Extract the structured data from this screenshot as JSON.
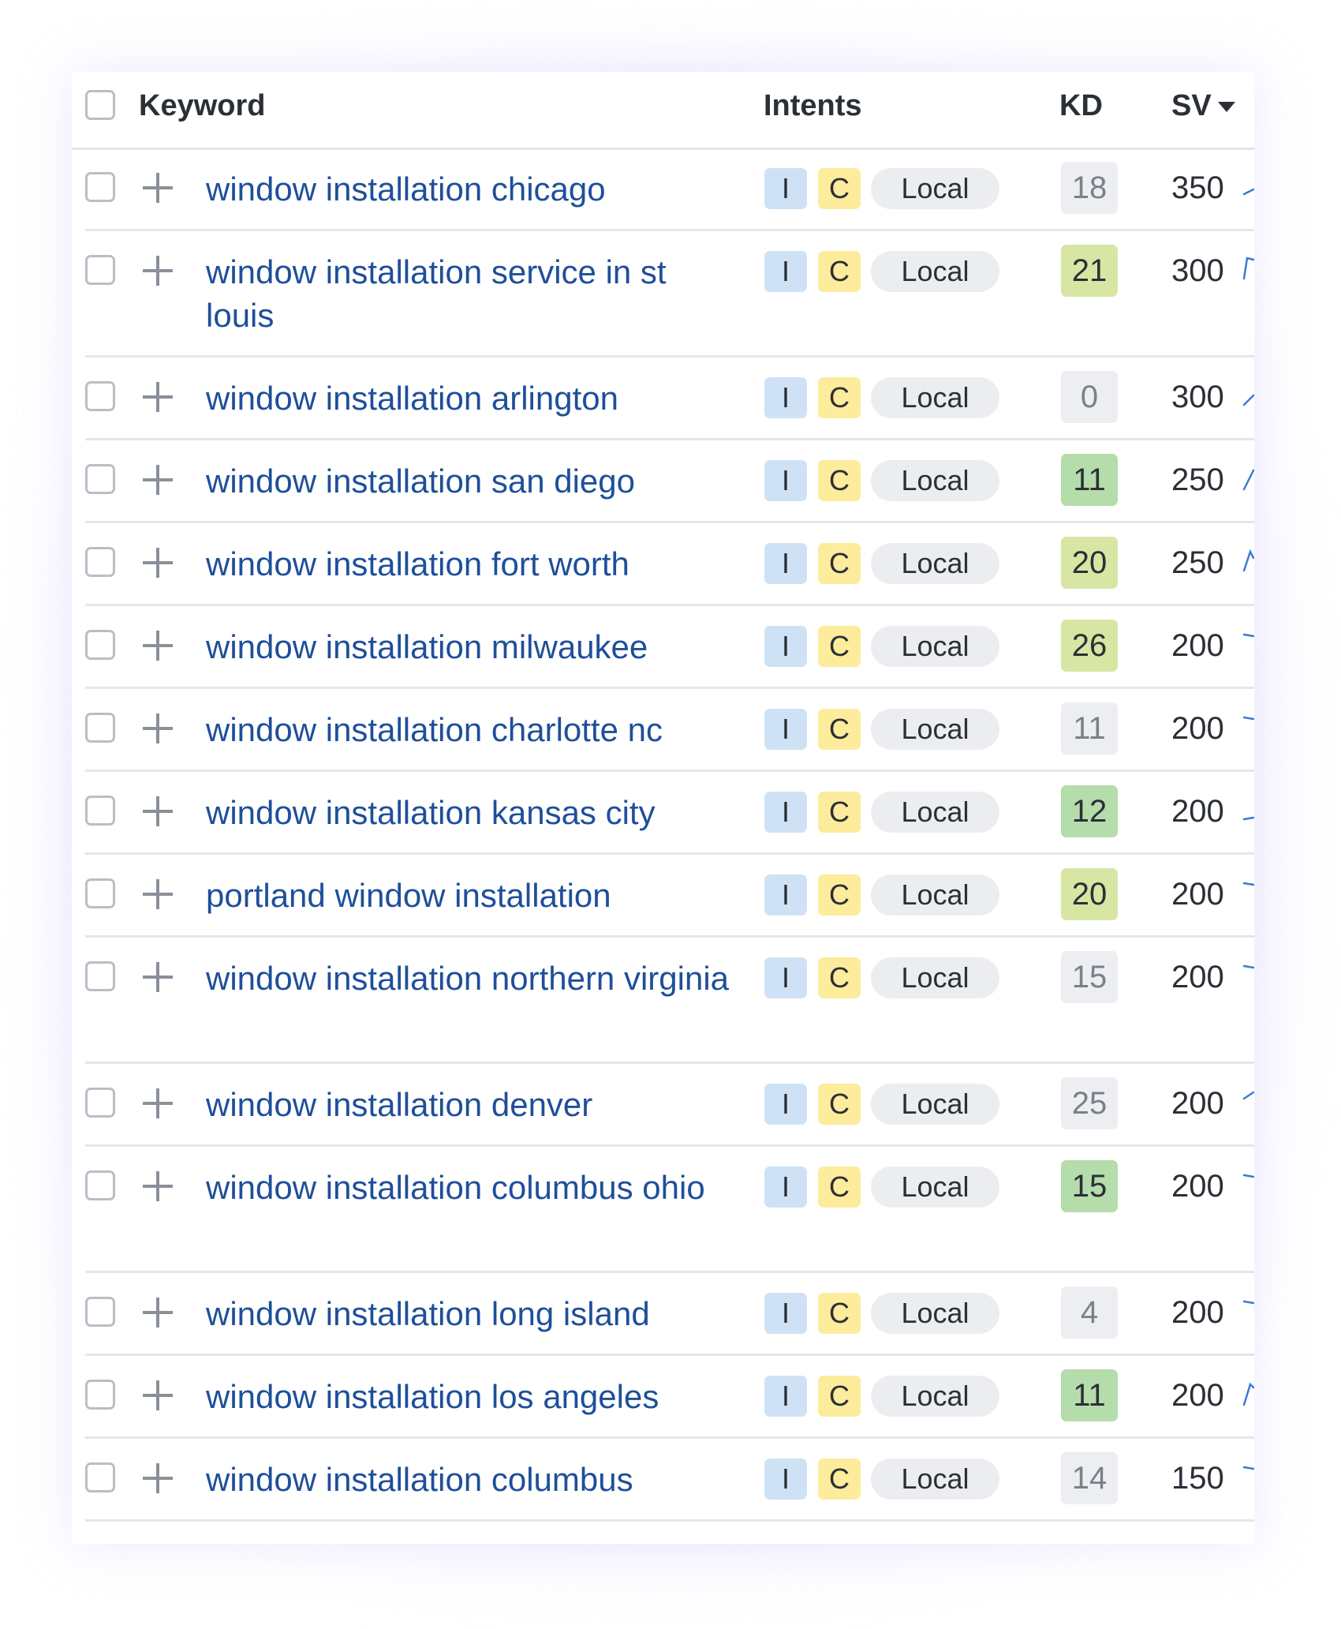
{
  "header": {
    "keyword": "Keyword",
    "intents": "Intents",
    "kd": "KD",
    "sv": "SV"
  },
  "rows": [
    {
      "keyword": "window installation chicago",
      "intents": [
        "I",
        "C",
        "Local"
      ],
      "kd": "18",
      "kd_level": "low",
      "sv": "350"
    },
    {
      "keyword": "window installation service in st louis",
      "intents": [
        "I",
        "C",
        "Local"
      ],
      "kd": "21",
      "kd_level": "mid",
      "sv": "300"
    },
    {
      "keyword": "window installation arlington",
      "intents": [
        "I",
        "C",
        "Local"
      ],
      "kd": "0",
      "kd_level": "low",
      "sv": "300"
    },
    {
      "keyword": "window installation san diego",
      "intents": [
        "I",
        "C",
        "Local"
      ],
      "kd": "11",
      "kd_level": "easy",
      "sv": "250"
    },
    {
      "keyword": "window installation fort worth",
      "intents": [
        "I",
        "C",
        "Local"
      ],
      "kd": "20",
      "kd_level": "mid",
      "sv": "250"
    },
    {
      "keyword": "window installation milwaukee",
      "intents": [
        "I",
        "C",
        "Local"
      ],
      "kd": "26",
      "kd_level": "mid",
      "sv": "200"
    },
    {
      "keyword": "window installation charlotte nc",
      "intents": [
        "I",
        "C",
        "Local"
      ],
      "kd": "11",
      "kd_level": "low",
      "sv": "200"
    },
    {
      "keyword": "window installation kansas city",
      "intents": [
        "I",
        "C",
        "Local"
      ],
      "kd": "12",
      "kd_level": "easy",
      "sv": "200"
    },
    {
      "keyword": "portland window installation",
      "intents": [
        "I",
        "C",
        "Local"
      ],
      "kd": "20",
      "kd_level": "mid",
      "sv": "200"
    },
    {
      "keyword": "window installation northern virginia",
      "intents": [
        "I",
        "C",
        "Local"
      ],
      "kd": "15",
      "kd_level": "low",
      "sv": "200"
    },
    {
      "keyword": "window installation denver",
      "intents": [
        "I",
        "C",
        "Local"
      ],
      "kd": "25",
      "kd_level": "low",
      "sv": "200"
    },
    {
      "keyword": "window installation columbus ohio",
      "intents": [
        "I",
        "C",
        "Local"
      ],
      "kd": "15",
      "kd_level": "easy",
      "sv": "200"
    },
    {
      "keyword": "window installation long island",
      "intents": [
        "I",
        "C",
        "Local"
      ],
      "kd": "4",
      "kd_level": "low",
      "sv": "200"
    },
    {
      "keyword": "window installation los angeles",
      "intents": [
        "I",
        "C",
        "Local"
      ],
      "kd": "11",
      "kd_level": "easy",
      "sv": "200"
    },
    {
      "keyword": "window installation columbus",
      "intents": [
        "I",
        "C",
        "Local"
      ],
      "kd": "14",
      "kd_level": "low",
      "sv": "150"
    }
  ],
  "colors": {
    "keyword_link": "#1e4f9a",
    "intent_informational": "#cfe2f5",
    "intent_commercial": "#fcec9b",
    "intent_local": "#ebedf0",
    "kd_low": "#eceef1",
    "kd_mid": "#d8e6a4",
    "kd_easy": "#b5dcab",
    "trend_line": "#3b7bd6"
  },
  "icons": {
    "sort": "sort-desc-icon",
    "add": "plus-icon",
    "trend": "trend-sparkline-icon"
  }
}
